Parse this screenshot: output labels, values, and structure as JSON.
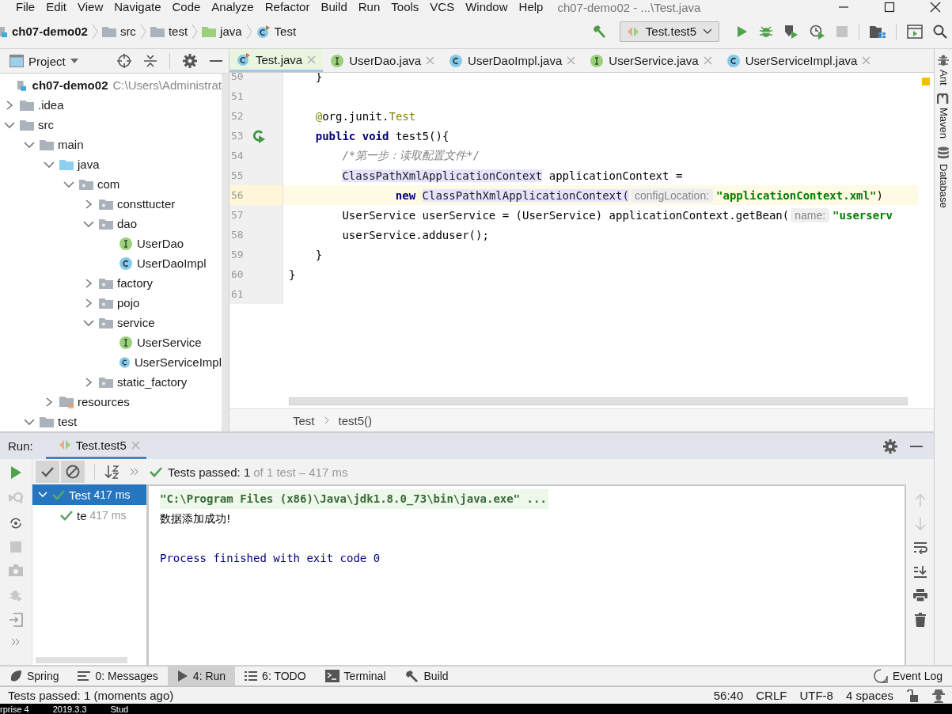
{
  "menu": [
    "File",
    "Edit",
    "View",
    "Navigate",
    "Code",
    "Analyze",
    "Refactor",
    "Build",
    "Run",
    "Tools",
    "VCS",
    "Window",
    "Help"
  ],
  "window_title": "ch07-demo02 - ...\\Test.java",
  "breadcrumbs": [
    {
      "label": "ch07-demo02",
      "kind": "module"
    },
    {
      "label": "src",
      "kind": "folder"
    },
    {
      "label": "test",
      "kind": "folder"
    },
    {
      "label": "java",
      "kind": "source"
    },
    {
      "label": "Test",
      "kind": "test-class"
    }
  ],
  "run_config": "Test.test5",
  "project_panel": {
    "title": "Project"
  },
  "project_tree": [
    {
      "label": "ch07-demo02",
      "kind": "module",
      "path": "C:\\Users\\Administrat",
      "children": [
        {
          "label": ".idea",
          "kind": "folder",
          "expanded": false
        },
        {
          "label": "src",
          "kind": "folder",
          "expanded": true,
          "children": [
            {
              "label": "main",
              "kind": "folder",
              "expanded": true,
              "children": [
                {
                  "label": "java",
                  "kind": "source",
                  "expanded": true,
                  "children": [
                    {
                      "label": "com",
                      "kind": "package",
                      "expanded": true,
                      "children": [
                        {
                          "label": "consttucter",
                          "kind": "package",
                          "expanded": false
                        },
                        {
                          "label": "dao",
                          "kind": "package",
                          "expanded": true,
                          "children": [
                            {
                              "label": "UserDao",
                              "kind": "interface"
                            },
                            {
                              "label": "UserDaoImpl",
                              "kind": "class"
                            }
                          ]
                        },
                        {
                          "label": "factory",
                          "kind": "package",
                          "expanded": false
                        },
                        {
                          "label": "pojo",
                          "kind": "package",
                          "expanded": false
                        },
                        {
                          "label": "service",
                          "kind": "package",
                          "expanded": true,
                          "children": [
                            {
                              "label": "UserService",
                              "kind": "interface"
                            },
                            {
                              "label": "UserServiceImpl",
                              "kind": "class"
                            }
                          ]
                        },
                        {
                          "label": "static_factory",
                          "kind": "package",
                          "expanded": false
                        }
                      ]
                    }
                  ]
                },
                {
                  "label": "resources",
                  "kind": "resources",
                  "expanded": false
                }
              ]
            },
            {
              "label": "test",
              "kind": "folder",
              "expanded": true
            }
          ]
        }
      ]
    }
  ],
  "editor_tabs": [
    {
      "label": "Test.java",
      "kind": "test-class",
      "selected": true
    },
    {
      "label": "UserDao.java",
      "kind": "interface",
      "selected": false
    },
    {
      "label": "UserDaoImpl.java",
      "kind": "class",
      "selected": false
    },
    {
      "label": "UserService.java",
      "kind": "interface",
      "selected": false
    },
    {
      "label": "UserServiceImpl.java",
      "kind": "class",
      "selected": false
    }
  ],
  "code_lines": [
    {
      "number": "50",
      "tokens": [
        {
          "text": "    }",
          "kind": "plain"
        }
      ]
    },
    {
      "number": "51"
    },
    {
      "number": "52",
      "tokens": [
        {
          "text": "    @",
          "kind": "annotation"
        },
        {
          "text": "org.junit.",
          "kind": "plain"
        },
        {
          "text": "Test",
          "kind": "annotation"
        }
      ]
    },
    {
      "number": "53",
      "run_marker": true,
      "tokens": [
        {
          "text": "    public void",
          "kind": "keyword"
        },
        {
          "text": " test5(){",
          "kind": "plain"
        }
      ]
    },
    {
      "number": "54",
      "tokens": [
        {
          "text": "        /*第一步：读取配置文件*/",
          "kind": "comment"
        }
      ]
    },
    {
      "number": "55",
      "tokens": [
        {
          "text": "        ClassPathXmlApplicationContext",
          "kind": "usage"
        },
        {
          "text": " applicationContext =",
          "kind": "plain"
        }
      ]
    },
    {
      "number": "56",
      "current": true,
      "tokens": [
        {
          "text": "                new",
          "kind": "keyword"
        },
        {
          "text": " ClassPathXmlApplicationContext(",
          "kind": "usage"
        },
        {
          "text": "configLocation:",
          "kind": "hint"
        },
        {
          "text": "\"applicationContext.xml\"",
          "kind": "string"
        },
        {
          "text": ")",
          "kind": "plain"
        }
      ]
    },
    {
      "number": "57",
      "tokens": [
        {
          "text": "        UserService userService = (UserService) applicationContext.getBean(",
          "kind": "plain"
        },
        {
          "text": "name:",
          "kind": "hint"
        },
        {
          "text": "\"userserv",
          "kind": "string"
        }
      ]
    },
    {
      "number": "58",
      "tokens": [
        {
          "text": "        userService.adduser();",
          "kind": "plain"
        }
      ]
    },
    {
      "number": "59",
      "tokens": [
        {
          "text": "    }",
          "kind": "plain"
        }
      ]
    },
    {
      "number": "60",
      "tokens": [
        {
          "text": "}",
          "kind": "plain"
        }
      ]
    },
    {
      "number": "61"
    }
  ],
  "editor_breadcrumbs": [
    "Test",
    "test5()"
  ],
  "right_strip": [
    {
      "label": "Ant",
      "kind": "ant"
    },
    {
      "label": "Maven",
      "kind": "maven"
    },
    {
      "label": "Database",
      "kind": "database"
    }
  ],
  "run_panel": {
    "title": "Run:",
    "tab": "Test.test5",
    "toggles": [
      {
        "kind": "passed",
        "selected": true
      },
      {
        "kind": "ignored",
        "selected": true
      }
    ],
    "summary": "Tests passed: 1",
    "summary_detail": "of 1 test – 417 ms",
    "tests": [
      {
        "name": "Test",
        "time": "417 ms",
        "selected": true,
        "expanded": true,
        "children": [
          {
            "name": "te",
            "time": "417 ms",
            "selected": false
          }
        ]
      }
    ],
    "console": [
      {
        "text": "\"C:\\Program Files (x86)\\Java\\jdk1.8.0_73\\bin\\java.exe\" ...",
        "kind": "command"
      },
      {
        "text": "数据添加成功!",
        "kind": "output"
      },
      {
        "text": "Process finished with exit code 0",
        "kind": "system"
      }
    ]
  },
  "tool_buttons": [
    {
      "label": "Spring",
      "kind": "spring",
      "selected": false
    },
    {
      "label": "0: Messages",
      "kind": "messages",
      "selected": false
    },
    {
      "label": "4: Run",
      "kind": "run",
      "selected": true
    },
    {
      "label": "6: TODO",
      "kind": "todo",
      "selected": false
    },
    {
      "label": "Terminal",
      "kind": "terminal",
      "selected": false
    },
    {
      "label": "Build",
      "kind": "build",
      "selected": false
    }
  ],
  "event_log": "Event Log",
  "status_bar": {
    "message": "Tests passed: 1 (moments ago)",
    "position": "56:40",
    "line_separator": "CRLF",
    "encoding": "UTF-8",
    "indent": "4 spaces"
  },
  "taskbar": [
    "rprise 4",
    "2019.3.3",
    "Stud"
  ]
}
